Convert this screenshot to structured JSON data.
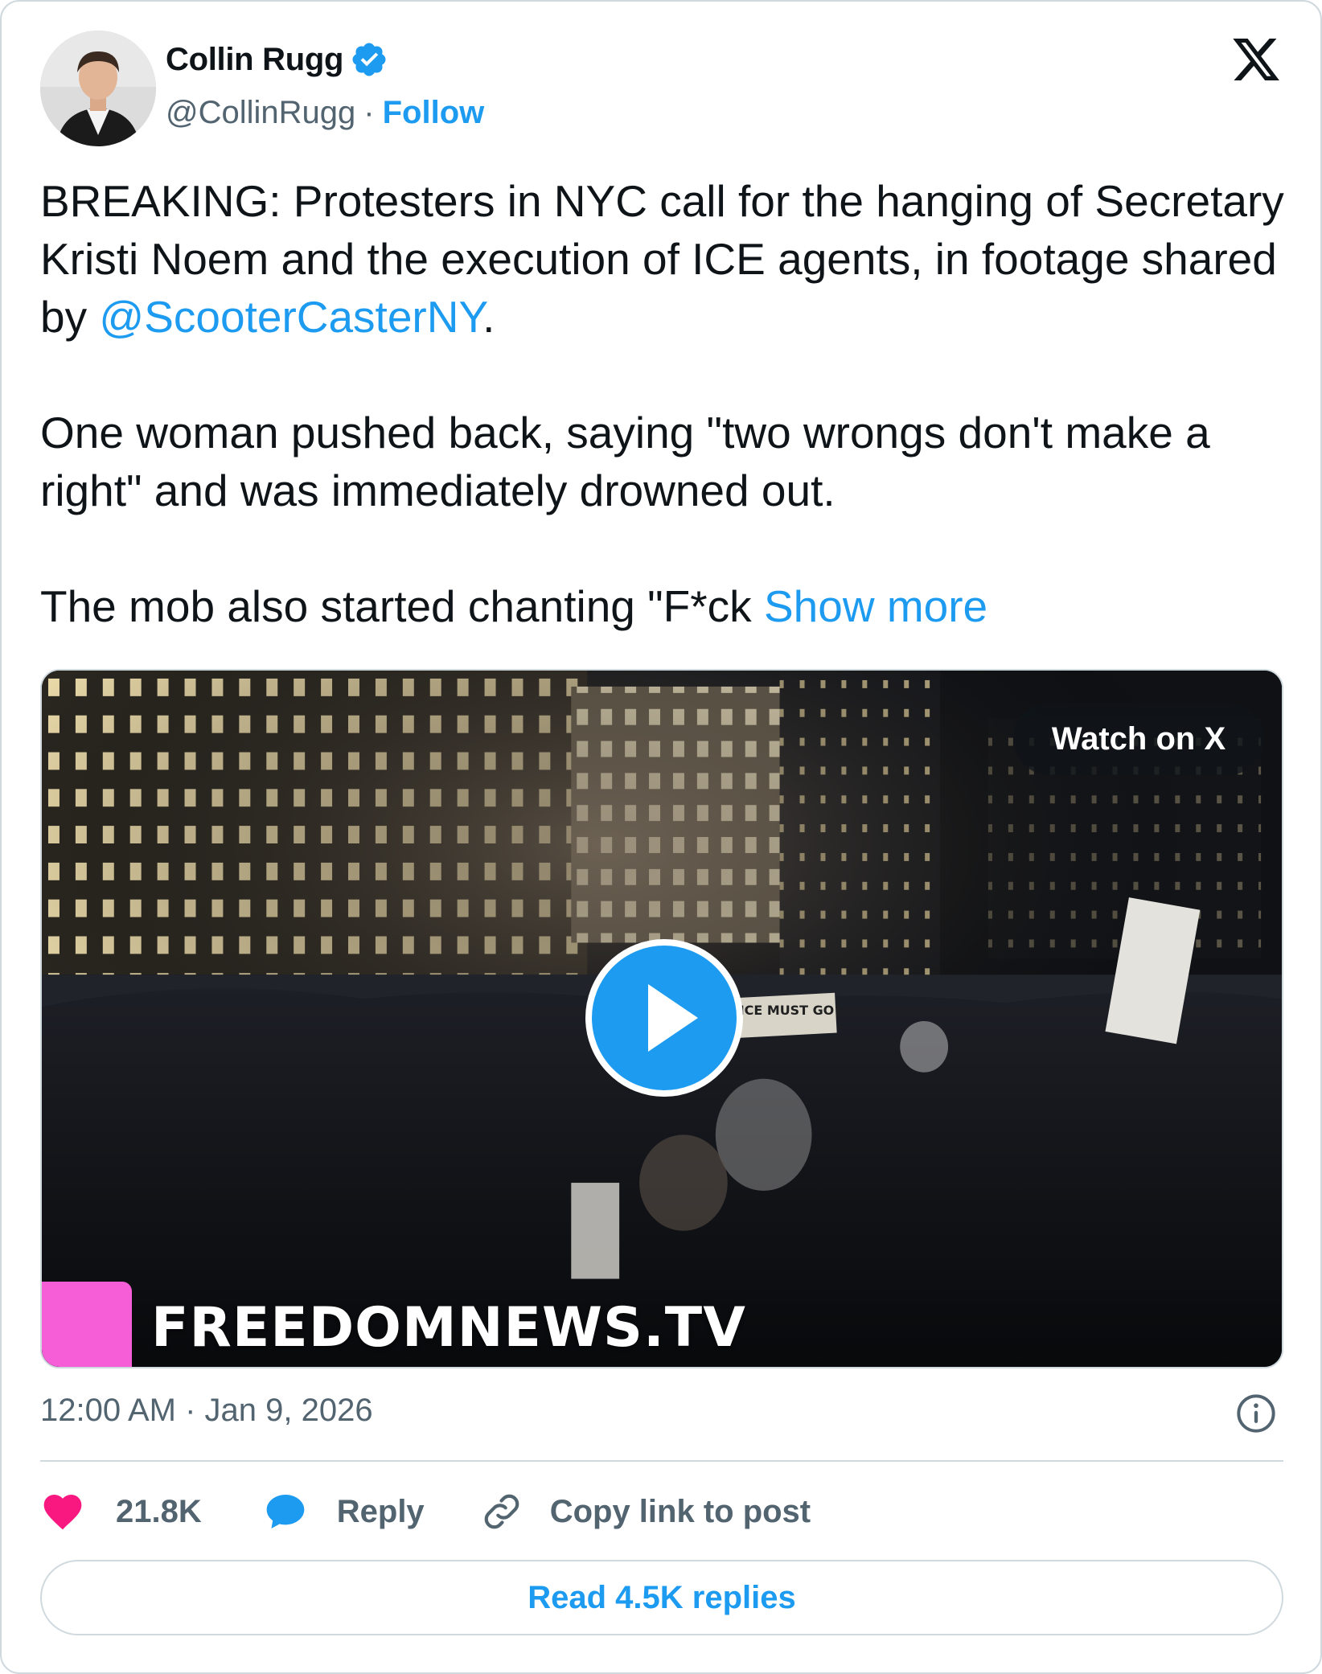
{
  "author": {
    "display_name": "Collin Rugg",
    "handle": "@CollinRugg",
    "separator": "·",
    "follow_label": "Follow",
    "verified": true
  },
  "tweet": {
    "paragraph1_pre": "BREAKING: Protesters in NYC call for the hanging of Secretary Kristi Noem and the execution of ICE agents, in footage shared by ",
    "mention": "@ScooterCasterNY",
    "paragraph1_post": ".",
    "paragraph2": "One woman pushed back, saying \"two wrongs don't make a right\" and was immediately drowned out.",
    "paragraph3_pre": "The mob also started chanting \"F*ck ",
    "show_more": "Show more"
  },
  "media": {
    "watch_label": "Watch on X",
    "watermark": "FREEDOMNEWS.TV",
    "sign_text": "ICE MUST GO!"
  },
  "meta": {
    "timestamp": "12:00 AM · Jan 9, 2026"
  },
  "actions": {
    "likes": "21.8K",
    "reply_label": "Reply",
    "copy_label": "Copy link to post"
  },
  "footer": {
    "read_replies": "Read 4.5K replies"
  },
  "colors": {
    "accent": "#1d9bf0",
    "like": "#f91880",
    "secondary_text": "#536471",
    "border": "#cfd9de",
    "watermark_box": "#f55ed6"
  }
}
